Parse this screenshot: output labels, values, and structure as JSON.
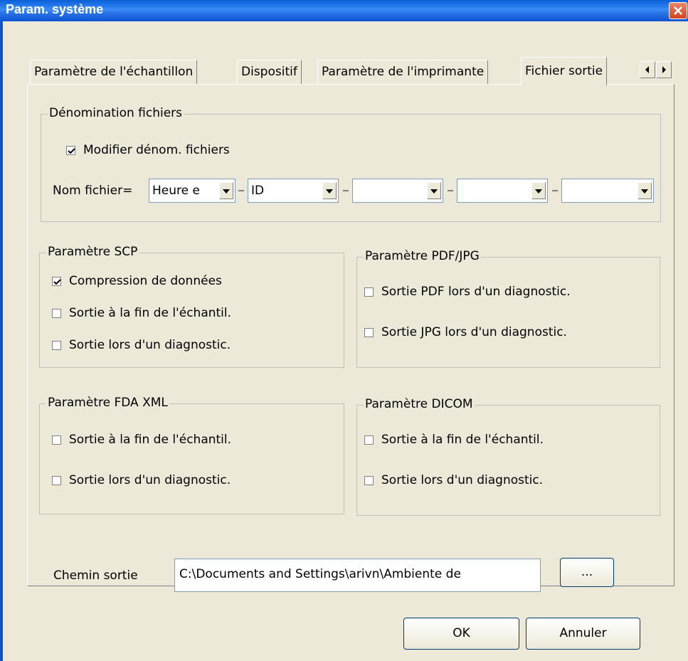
{
  "window": {
    "title": "Param. système"
  },
  "tabs": [
    {
      "label": "Paramètre de l'échantillon",
      "active": false
    },
    {
      "label": "Dispositif",
      "active": false
    },
    {
      "label": "Paramètre de l'imprimante",
      "active": false
    },
    {
      "label": "Fichier sortie",
      "active": true
    }
  ],
  "naming": {
    "group_label": "Dénomination fichiers",
    "modify_label": "Modifier dénom. fichiers",
    "modify_checked": true,
    "filename_label": "Nom fichier=",
    "fields": [
      "Heure e",
      "ID",
      "",
      "",
      ""
    ]
  },
  "scp": {
    "group_label": "Paramètre SCP",
    "options": [
      {
        "label": "Compression de données",
        "checked": true
      },
      {
        "label": "Sortie à la fin de l'échantil.",
        "checked": false
      },
      {
        "label": "Sortie lors d'un diagnostic.",
        "checked": false
      }
    ]
  },
  "pdf": {
    "group_label": "Paramètre PDF/JPG",
    "options": [
      {
        "label": "Sortie PDF lors d'un diagnostic.",
        "checked": false
      },
      {
        "label": "Sortie JPG lors d'un diagnostic.",
        "checked": false
      }
    ]
  },
  "fda": {
    "group_label": "Paramètre FDA XML",
    "options": [
      {
        "label": "Sortie à la fin de l'échantil.",
        "checked": false
      },
      {
        "label": "Sortie lors d'un diagnostic.",
        "checked": false
      }
    ]
  },
  "dicom": {
    "group_label": "Paramètre DICOM",
    "options": [
      {
        "label": "Sortie à la fin de l'échantil.",
        "checked": false
      },
      {
        "label": "Sortie lors d'un diagnostic.",
        "checked": false
      }
    ]
  },
  "output": {
    "path_label": "Chemin sortie",
    "path_value": "C:\\Documents and Settings\\arivn\\Ambiente de",
    "browse_label": "..."
  },
  "buttons": {
    "ok": "OK",
    "cancel": "Annuler"
  },
  "colors": {
    "titlebar": "#0d54d2",
    "face": "#ece9d8",
    "button_border": "#003c74"
  }
}
